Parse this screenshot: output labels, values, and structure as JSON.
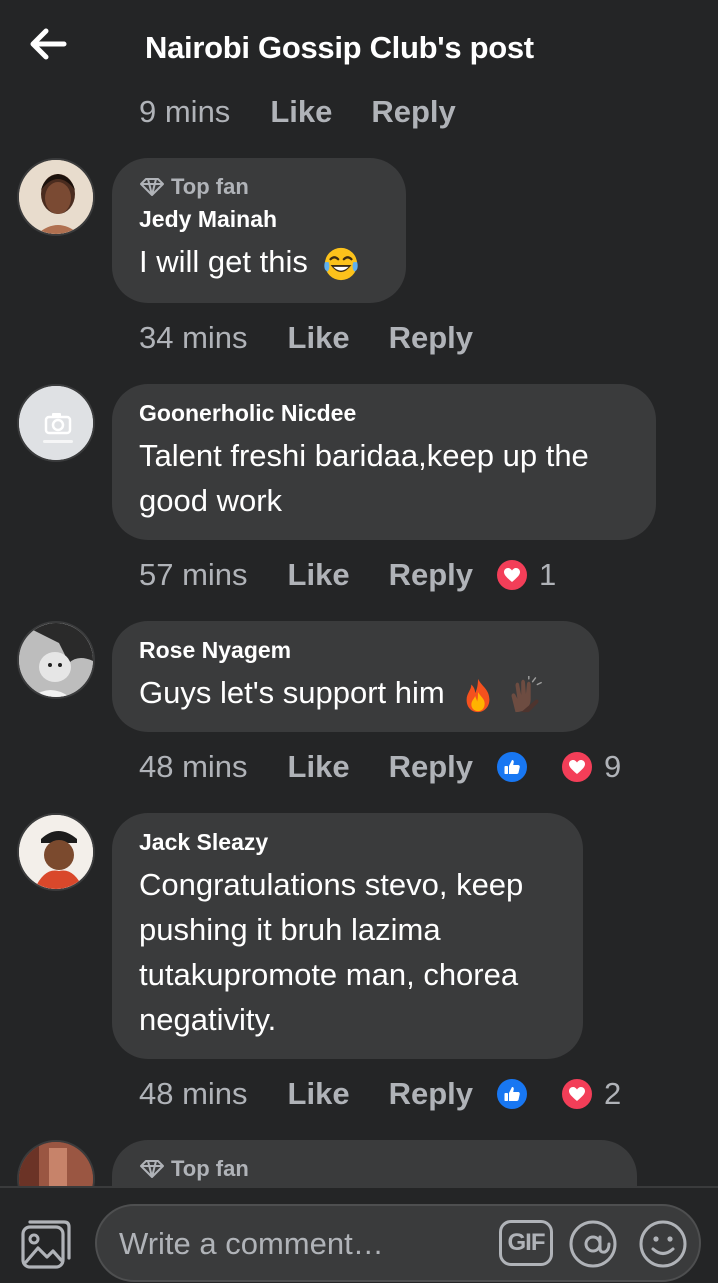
{
  "header": {
    "title": "Nairobi Gossip Club's post"
  },
  "top_meta": {
    "time": "9 mins",
    "like": "Like",
    "reply": "Reply"
  },
  "comments": [
    {
      "badge": "Top fan",
      "author": "Jedy Mainah",
      "text": "I will get this",
      "emoji": [
        "laughing-tears-emoji"
      ],
      "time": "34 mins",
      "like": "Like",
      "reply": "Reply",
      "reactions": [],
      "reaction_count": ""
    },
    {
      "badge": "",
      "author": "Goonerholic Nicdee",
      "text_line1": "Talent freshi baridaa,keep up the",
      "text_line2": "good work",
      "time": "57 mins",
      "like": "Like",
      "reply": "Reply",
      "reactions": [
        "love"
      ],
      "reaction_count": "1"
    },
    {
      "badge": "",
      "author": "Rose Nyagem",
      "text": "Guys let's support him",
      "emoji": [
        "fire-emoji",
        "clapping-hands-emoji"
      ],
      "time": "48 mins",
      "like": "Like",
      "reply": "Reply",
      "reactions": [
        "like",
        "love"
      ],
      "reaction_count": "9"
    },
    {
      "badge": "",
      "author": "Jack Sleazy",
      "text_line1": "Congratulations stevo, keep",
      "text_line2": "pushing it bruh lazima",
      "text_line3": "tutakupromote man, chorea",
      "text_line4": "negativity.",
      "time": "48 mins",
      "like": "Like",
      "reply": "Reply",
      "reactions": [
        "like",
        "love"
      ],
      "reaction_count": "2"
    },
    {
      "badge": "Top fan"
    }
  ],
  "composer": {
    "placeholder": "Write a comment…",
    "gif_label": "GIF"
  },
  "colors": {
    "background": "#242526",
    "bubble": "#3a3b3c",
    "secondary_text": "#b0b3b8",
    "like_blue": "#1877f2",
    "love_red": "#f33e58"
  }
}
